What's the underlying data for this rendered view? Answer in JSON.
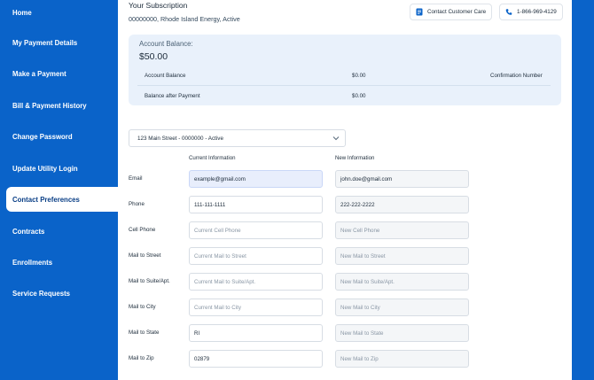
{
  "sidebar": {
    "items": [
      {
        "label": "Home"
      },
      {
        "label": "My Payment Details"
      },
      {
        "label": "Make a Payment"
      },
      {
        "label": "Bill & Payment History"
      },
      {
        "label": "Change Password"
      },
      {
        "label": "Update Utility Login"
      },
      {
        "label": "Contact Preferences",
        "active": true
      },
      {
        "label": "Contracts"
      },
      {
        "label": "Enrollments"
      },
      {
        "label": "Service Requests"
      }
    ]
  },
  "header": {
    "title": "Your Subscription",
    "account": "00000000, Rhode Island Energy, Active",
    "contact_button": "Contact Customer Care",
    "phone_button": "1-866-969-4129"
  },
  "balance": {
    "label": "Account Balance:",
    "amount": "$50.00",
    "rows": [
      {
        "label": "Account Balance",
        "value": "$0.00",
        "extra": "Confirmation Number"
      },
      {
        "label": "Balance after Payment",
        "value": "$0.00",
        "extra": ""
      }
    ]
  },
  "address_select": {
    "value": "123 Main Street - 0000000 - Active"
  },
  "form": {
    "current_header": "Current Information",
    "new_header": "New Information",
    "rows": [
      {
        "label": "Email",
        "current": "example@gmail.com",
        "current_ph": "",
        "new": "john.doe@gmail.com",
        "new_ph": ""
      },
      {
        "label": "Phone",
        "current": "111-111-1111",
        "current_ph": "",
        "new": "222-222-2222",
        "new_ph": ""
      },
      {
        "label": "Cell Phone",
        "current": "",
        "current_ph": "Current Cell Phone",
        "new": "",
        "new_ph": "New Cell Phone"
      },
      {
        "label": "Mail to Street",
        "current": "",
        "current_ph": "Current Mail to Street",
        "new": "",
        "new_ph": "New Mail to Street"
      },
      {
        "label": "Mail to Suite/Apt.",
        "current": "",
        "current_ph": "Current Mail to Suite/Apt.",
        "new": "",
        "new_ph": "New Mail to Suite/Apt."
      },
      {
        "label": "Mail to City",
        "current": "",
        "current_ph": "Current Mail to City",
        "new": "",
        "new_ph": "New Mail to City"
      },
      {
        "label": "Mail to State",
        "current": "RI",
        "current_ph": "",
        "new": "",
        "new_ph": "New Mail to State"
      },
      {
        "label": "Mail to Zip",
        "current": "02879",
        "current_ph": "",
        "new": "",
        "new_ph": "New Mail to Zip"
      }
    ]
  },
  "colors": {
    "brand_blue": "#0a63c9",
    "card_bg": "#e9f1fb",
    "focused_field": "#e8eefc"
  },
  "icons": {
    "contact": "document-icon",
    "phone": "phone-icon",
    "dropdown": "chevron-down-icon"
  }
}
